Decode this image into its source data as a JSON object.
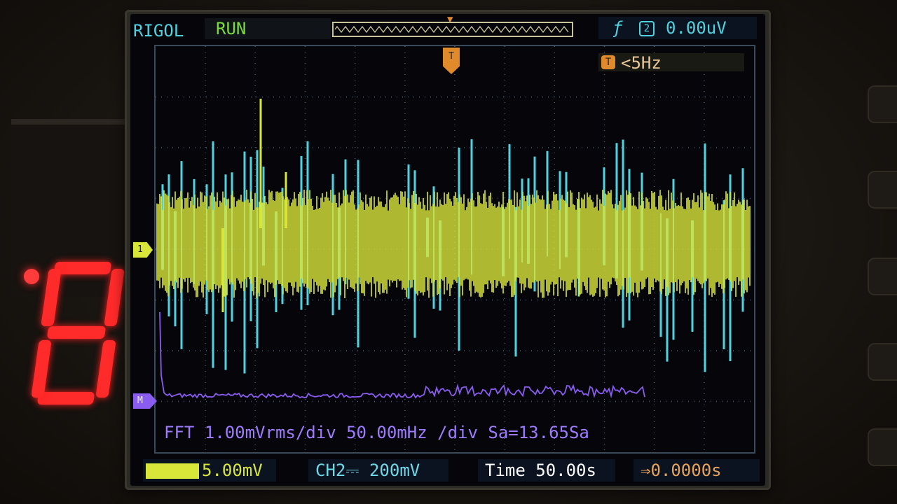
{
  "led_display": {
    "digit": "8",
    "dot_lit": true
  },
  "scope": {
    "brand": "RIGOL",
    "run_state": "RUN",
    "trigger": {
      "edge_icon": "rising-edge-icon",
      "source_icon": "channel-icon",
      "source_text": "2",
      "level": "0.00uV"
    },
    "frequency": {
      "icon_text": "T",
      "text": "<5Hz"
    },
    "markers": {
      "ch1": "1",
      "math": "M",
      "trig_pos": "T"
    },
    "fft_info": "FFT 1.00mVrms/div 50.00mHz /div Sa=13.65Sa",
    "bottom": {
      "ch1_scale": "5.00mV",
      "ch2_label": "CH2",
      "ch2_coupling_icon": "dc-coupling-icon",
      "ch2_scale": "200mV",
      "time_label": "Time",
      "time_value": "50.00s",
      "trig_offset": "0.0000s"
    },
    "colors": {
      "ch1": "#d8e63a",
      "ch2": "#4fd3e0",
      "math": "#8a5cf0",
      "trigger": "#e08a2c"
    }
  }
}
